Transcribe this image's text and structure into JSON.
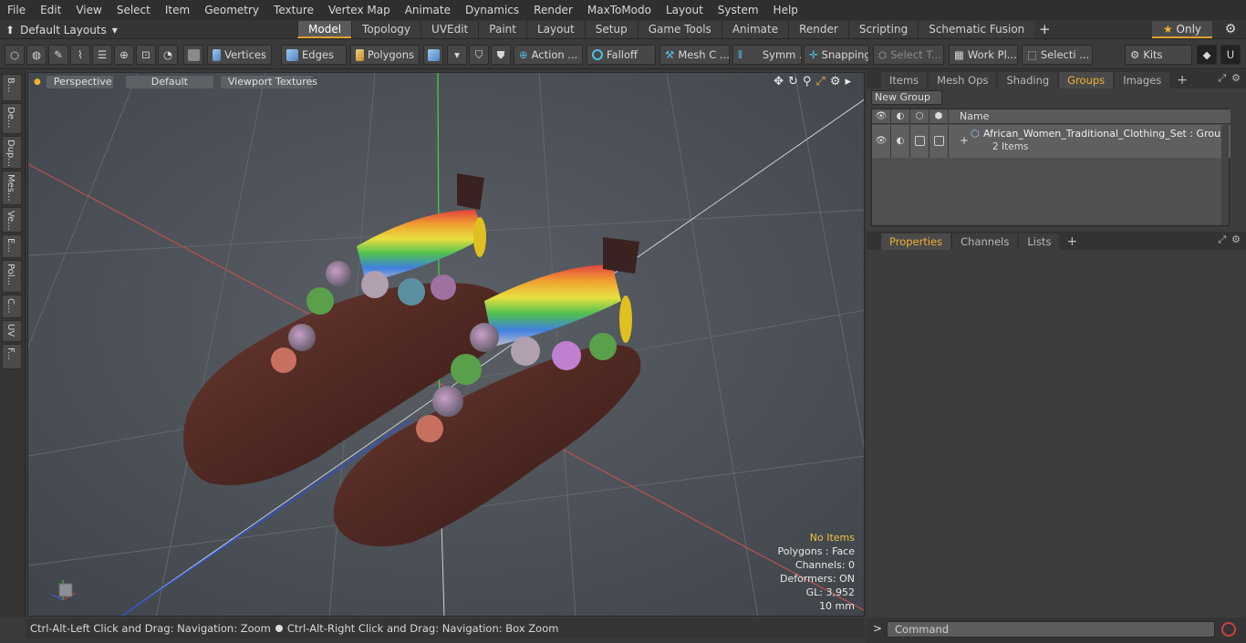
{
  "menu": [
    "File",
    "Edit",
    "View",
    "Select",
    "Item",
    "Geometry",
    "Texture",
    "Vertex Map",
    "Animate",
    "Dynamics",
    "Render",
    "MaxToModo",
    "Layout",
    "System",
    "Help"
  ],
  "layout_dropdown": "Default Layouts",
  "tabs": [
    "Model",
    "Topology",
    "UVEdit",
    "Paint",
    "Layout",
    "Setup",
    "Game Tools",
    "Animate",
    "Render",
    "Scripting",
    "Schematic Fusion"
  ],
  "active_tab": "Model",
  "only_label": "Only",
  "toolbar": {
    "vertices": "Vertices",
    "edges": "Edges",
    "polygons": "Polygons",
    "action": "Action ...",
    "falloff": "Falloff",
    "mesh": "Mesh C ...",
    "symmetry": "Symm ...",
    "snapping": "Snapping",
    "select_t": "Select T...",
    "work_plane": "Work Pl...",
    "selection": "Selecti ...",
    "kits": "Kits"
  },
  "left_tabs": [
    "B...",
    "De...",
    "Dup...",
    "Mes...",
    "Ve...",
    "E...",
    "Pol...",
    "C...",
    "UV",
    "F..."
  ],
  "viewport": {
    "view_mode": "Perspective",
    "shading": "Default",
    "textures": "Viewport Textures",
    "hud": {
      "selection": "No Items",
      "polygons": "Polygons : Face",
      "channels": "Channels: 0",
      "deformers": "Deformers: ON",
      "gl": "GL: 3,952",
      "scale": "10 mm"
    }
  },
  "status_hint_left": "Ctrl-Alt-Left Click and Drag: Navigation: Zoom",
  "status_hint_right": "Ctrl-Alt-Right Click and Drag: Navigation: Box Zoom",
  "top_panel_tabs": [
    "Items",
    "Mesh Ops",
    "Shading",
    "Groups",
    "Images"
  ],
  "top_panel_active": "Groups",
  "groups": {
    "new_group": "New Group",
    "name_header": "Name",
    "item_name": "African_Women_Traditional_Clothing_Set : Group",
    "item_count": "2 Items"
  },
  "bottom_panel_tabs": [
    "Properties",
    "Channels",
    "Lists"
  ],
  "bottom_panel_active": "Properties",
  "command_placeholder": "Command",
  "colors": {
    "accent": "#f0b030",
    "viewport_bg": "#4a5055"
  }
}
